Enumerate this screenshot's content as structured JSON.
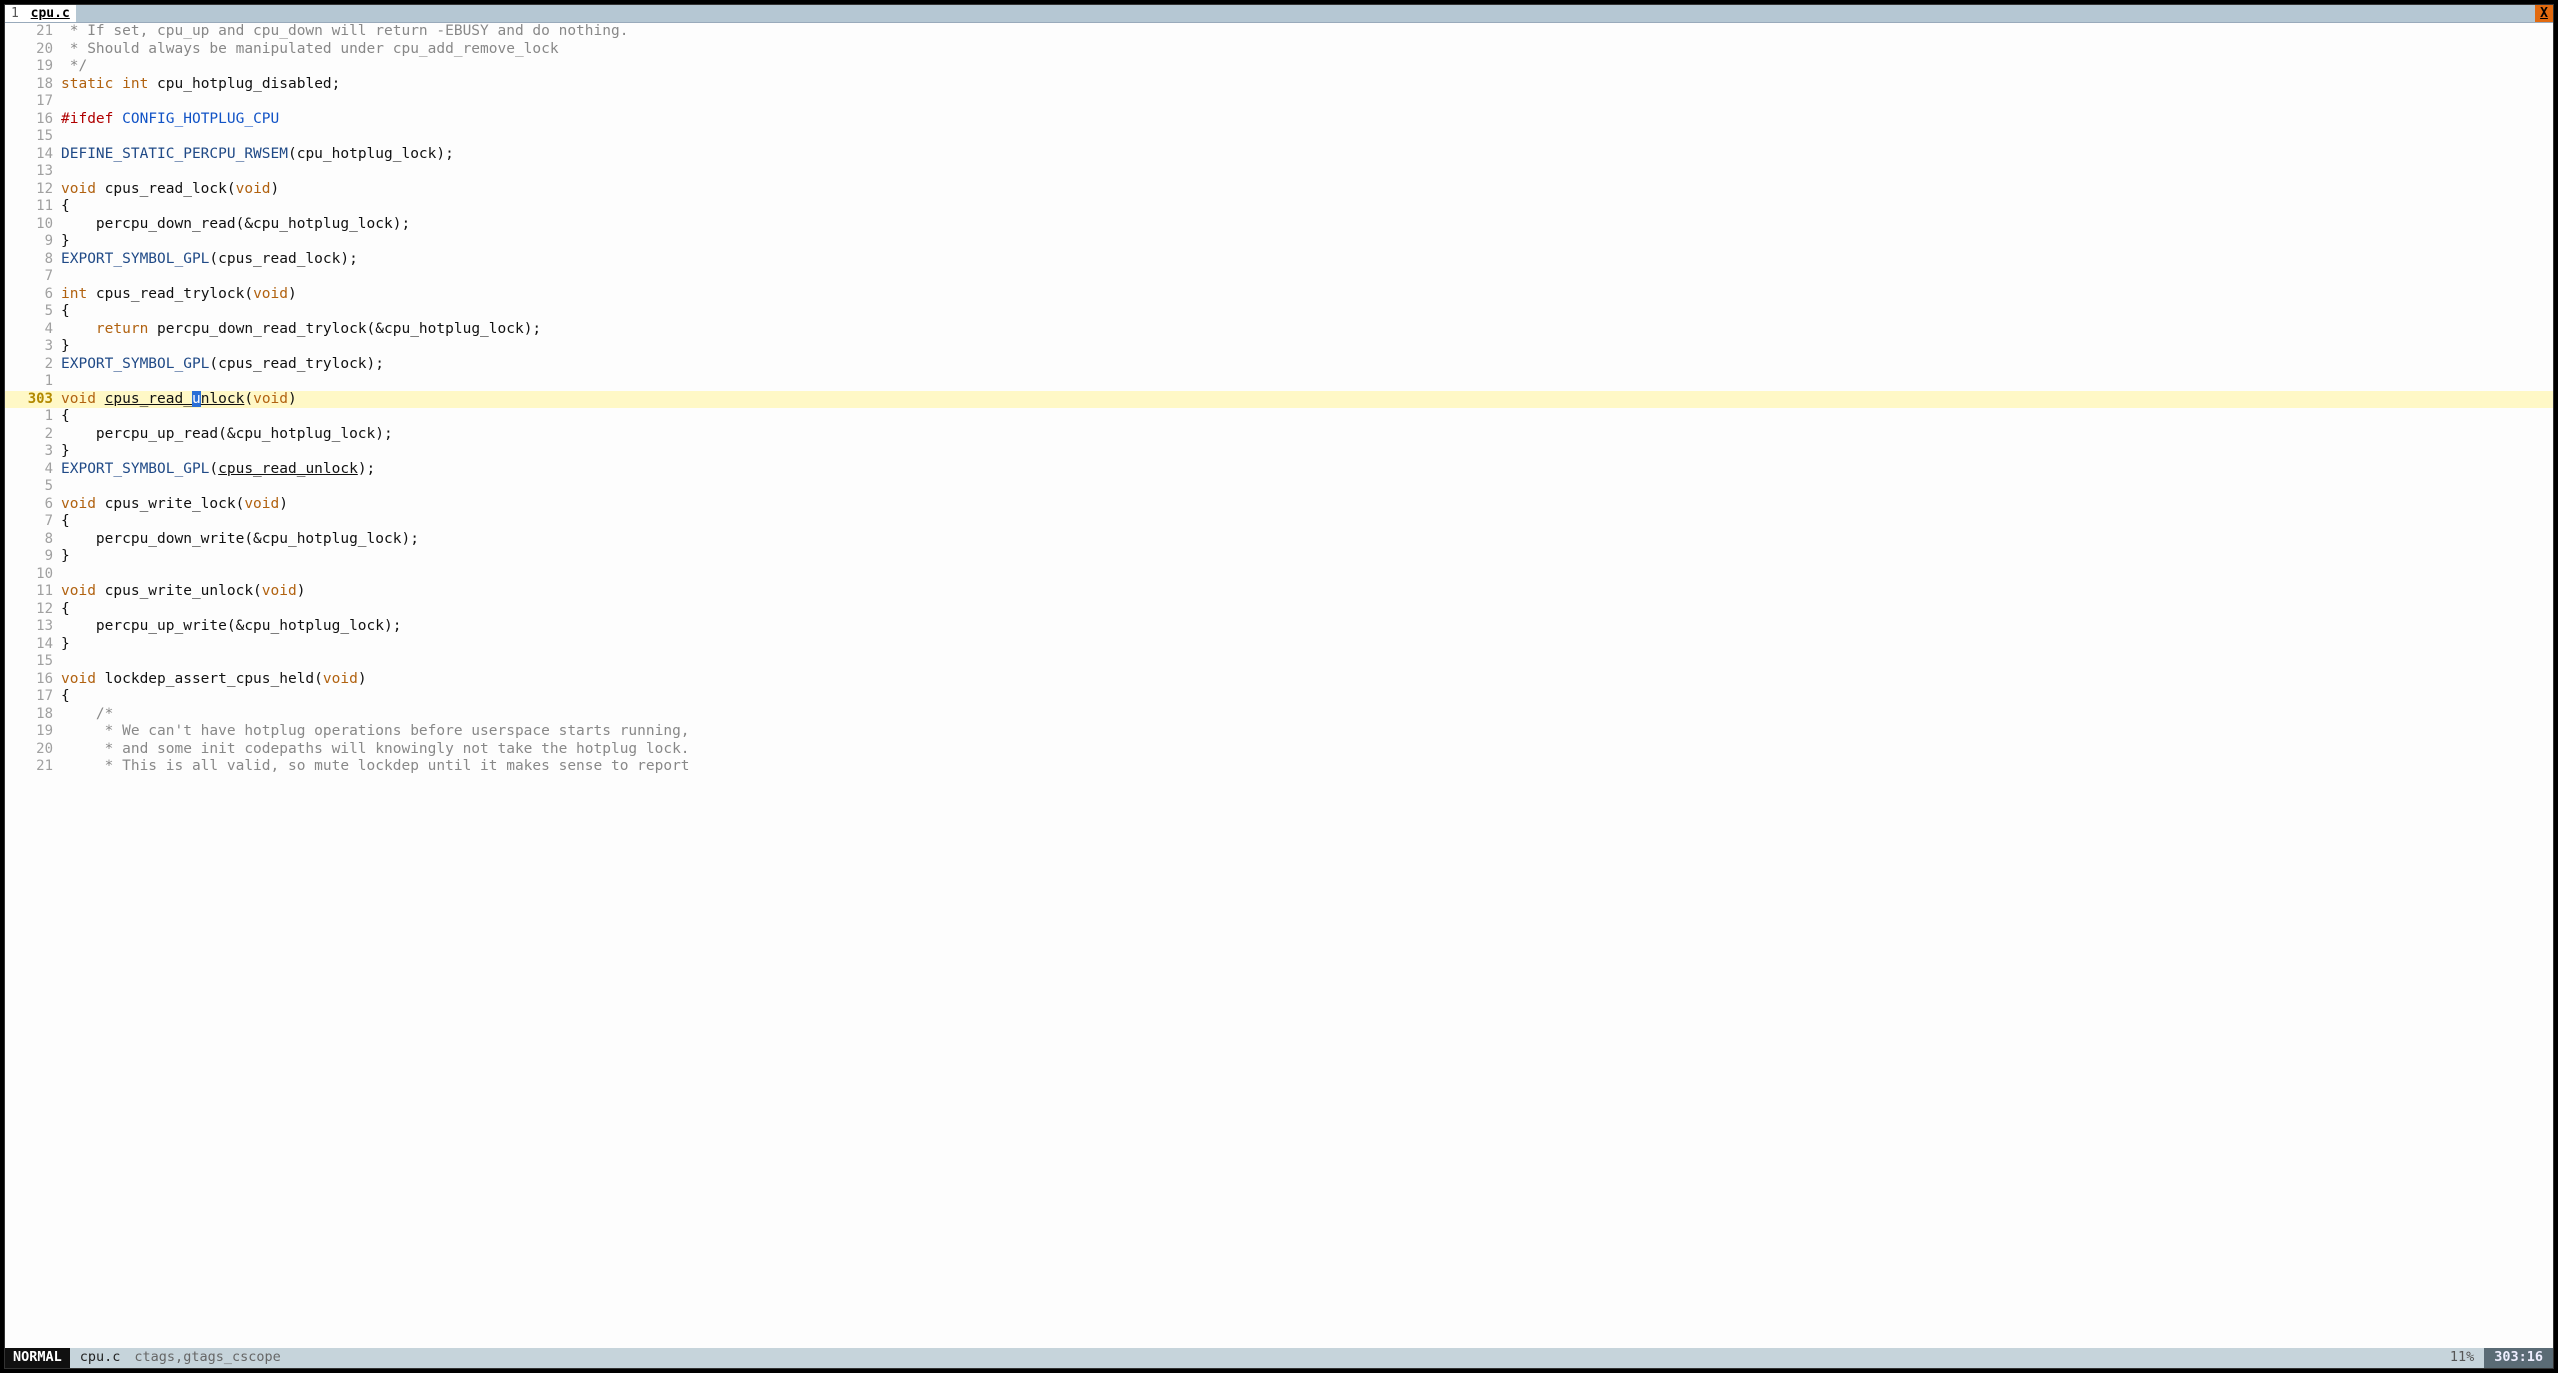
{
  "tab": {
    "index": "1",
    "name": "cpu.c",
    "close": "X"
  },
  "status": {
    "mode": "NORMAL",
    "file": "cpu.c",
    "tags": "ctags,gtags_cscope",
    "percent": "11%",
    "pos": "303:16"
  },
  "colors": {
    "tabbar": "#b5c7d3",
    "close_btn": "#e26a0f",
    "cur_line_bg": "#fff8c6",
    "cursor_bg": "#2a6fd6"
  },
  "current_line_number": "303",
  "code_lines": [
    {
      "rel": "21",
      "tokens": [
        {
          "t": " * If set, cpu_up and cpu_down will return -EBUSY and do nothing.",
          "c": "cmt"
        }
      ]
    },
    {
      "rel": "20",
      "tokens": [
        {
          "t": " * Should always be manipulated under cpu_add_remove_lock",
          "c": "cmt"
        }
      ]
    },
    {
      "rel": "19",
      "tokens": [
        {
          "t": " */",
          "c": "cmt"
        }
      ]
    },
    {
      "rel": "18",
      "tokens": [
        {
          "t": "static",
          "c": "type"
        },
        {
          "t": " "
        },
        {
          "t": "int",
          "c": "type"
        },
        {
          "t": " cpu_hotplug_disabled;"
        }
      ]
    },
    {
      "rel": "17",
      "tokens": []
    },
    {
      "rel": "16",
      "tokens": [
        {
          "t": "#ifdef",
          "c": "pp"
        },
        {
          "t": " "
        },
        {
          "t": "CONFIG_HOTPLUG_CPU",
          "c": "ppid"
        }
      ]
    },
    {
      "rel": "15",
      "tokens": []
    },
    {
      "rel": "14",
      "tokens": [
        {
          "t": "DEFINE_STATIC_PERCPU_RWSEM",
          "c": "func"
        },
        {
          "t": "(cpu_hotplug_lock);"
        }
      ]
    },
    {
      "rel": "13",
      "tokens": []
    },
    {
      "rel": "12",
      "tokens": [
        {
          "t": "void",
          "c": "type"
        },
        {
          "t": " cpus_read_lock("
        },
        {
          "t": "void",
          "c": "type"
        },
        {
          "t": ")"
        }
      ]
    },
    {
      "rel": "11",
      "tokens": [
        {
          "t": "{"
        }
      ]
    },
    {
      "rel": "10",
      "tokens": [
        {
          "t": "    percpu_down_read(&cpu_hotplug_lock);"
        }
      ]
    },
    {
      "rel": "9",
      "tokens": [
        {
          "t": "}"
        }
      ]
    },
    {
      "rel": "8",
      "tokens": [
        {
          "t": "EXPORT_SYMBOL_GPL",
          "c": "func"
        },
        {
          "t": "(cpus_read_lock);"
        }
      ]
    },
    {
      "rel": "7",
      "tokens": []
    },
    {
      "rel": "6",
      "tokens": [
        {
          "t": "int",
          "c": "type"
        },
        {
          "t": " cpus_read_trylock("
        },
        {
          "t": "void",
          "c": "type"
        },
        {
          "t": ")"
        }
      ]
    },
    {
      "rel": "5",
      "tokens": [
        {
          "t": "{"
        }
      ]
    },
    {
      "rel": "4",
      "tokens": [
        {
          "t": "    "
        },
        {
          "t": "return",
          "c": "type"
        },
        {
          "t": " percpu_down_read_trylock(&cpu_hotplug_lock);"
        }
      ]
    },
    {
      "rel": "3",
      "tokens": [
        {
          "t": "}"
        }
      ]
    },
    {
      "rel": "2",
      "tokens": [
        {
          "t": "EXPORT_SYMBOL_GPL",
          "c": "func"
        },
        {
          "t": "(cpus_read_trylock);"
        }
      ]
    },
    {
      "rel": "1",
      "tokens": []
    },
    {
      "rel": "303",
      "current": true,
      "tokens": [
        {
          "t": "void",
          "c": "type"
        },
        {
          "t": " "
        },
        {
          "t": "cpus_read_",
          "c": "ul"
        },
        {
          "t": "u",
          "c": "cursor"
        },
        {
          "t": "nlock",
          "c": "ul"
        },
        {
          "t": "("
        },
        {
          "t": "void",
          "c": "type"
        },
        {
          "t": ")"
        }
      ]
    },
    {
      "rel": "1",
      "tokens": [
        {
          "t": "{"
        }
      ]
    },
    {
      "rel": "2",
      "tokens": [
        {
          "t": "    percpu_up_read(&cpu_hotplug_lock);"
        }
      ]
    },
    {
      "rel": "3",
      "tokens": [
        {
          "t": "}"
        }
      ]
    },
    {
      "rel": "4",
      "tokens": [
        {
          "t": "EXPORT_SYMBOL_GPL",
          "c": "func"
        },
        {
          "t": "("
        },
        {
          "t": "cpus_read_unlock",
          "c": "ul"
        },
        {
          "t": ");"
        }
      ]
    },
    {
      "rel": "5",
      "tokens": []
    },
    {
      "rel": "6",
      "tokens": [
        {
          "t": "void",
          "c": "type"
        },
        {
          "t": " cpus_write_lock("
        },
        {
          "t": "void",
          "c": "type"
        },
        {
          "t": ")"
        }
      ]
    },
    {
      "rel": "7",
      "tokens": [
        {
          "t": "{"
        }
      ]
    },
    {
      "rel": "8",
      "tokens": [
        {
          "t": "    percpu_down_write(&cpu_hotplug_lock);"
        }
      ]
    },
    {
      "rel": "9",
      "tokens": [
        {
          "t": "}"
        }
      ]
    },
    {
      "rel": "10",
      "tokens": []
    },
    {
      "rel": "11",
      "tokens": [
        {
          "t": "void",
          "c": "type"
        },
        {
          "t": " cpus_write_unlock("
        },
        {
          "t": "void",
          "c": "type"
        },
        {
          "t": ")"
        }
      ]
    },
    {
      "rel": "12",
      "tokens": [
        {
          "t": "{"
        }
      ]
    },
    {
      "rel": "13",
      "tokens": [
        {
          "t": "    percpu_up_write(&cpu_hotplug_lock);"
        }
      ]
    },
    {
      "rel": "14",
      "tokens": [
        {
          "t": "}"
        }
      ]
    },
    {
      "rel": "15",
      "tokens": []
    },
    {
      "rel": "16",
      "tokens": [
        {
          "t": "void",
          "c": "type"
        },
        {
          "t": " lockdep_assert_cpus_held("
        },
        {
          "t": "void",
          "c": "type"
        },
        {
          "t": ")"
        }
      ]
    },
    {
      "rel": "17",
      "tokens": [
        {
          "t": "{"
        }
      ]
    },
    {
      "rel": "18",
      "tokens": [
        {
          "t": "    /*",
          "c": "cmt"
        }
      ]
    },
    {
      "rel": "19",
      "tokens": [
        {
          "t": "     * We can't have hotplug operations before userspace starts running,",
          "c": "cmt"
        }
      ]
    },
    {
      "rel": "20",
      "tokens": [
        {
          "t": "     * and some init codepaths will knowingly not take the hotplug lock.",
          "c": "cmt"
        }
      ]
    },
    {
      "rel": "21",
      "tokens": [
        {
          "t": "     * This is all valid, so mute lockdep until it makes sense to report",
          "c": "cmt"
        }
      ]
    }
  ]
}
